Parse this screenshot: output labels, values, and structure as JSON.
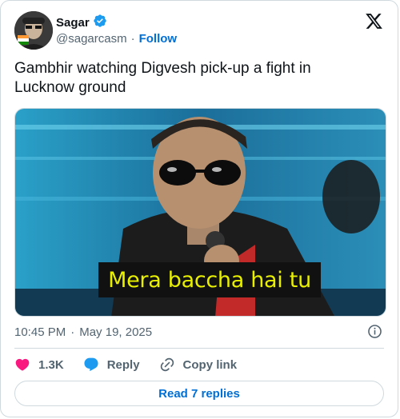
{
  "author": {
    "display_name": "Sagar",
    "handle": "@sagarcasm",
    "separator": "·",
    "follow_label": "Follow"
  },
  "tweet": {
    "text": "Gambhir watching Digvesh pick-up a fight in Lucknow ground",
    "media_caption": "Mera baccha hai tu",
    "time": "10:45 PM",
    "separator": "·",
    "date": "May 19, 2025"
  },
  "actions": {
    "likes": "1.3K",
    "reply_label": "Reply",
    "copy_link_label": "Copy link"
  },
  "footer": {
    "read_replies_label": "Read 7 replies"
  },
  "colors": {
    "like": "#f91880",
    "reply": "#1d9bf0",
    "link": "#006fd6",
    "verified": "#1d9bf0",
    "muted": "#536471",
    "border": "#cfd9de"
  }
}
